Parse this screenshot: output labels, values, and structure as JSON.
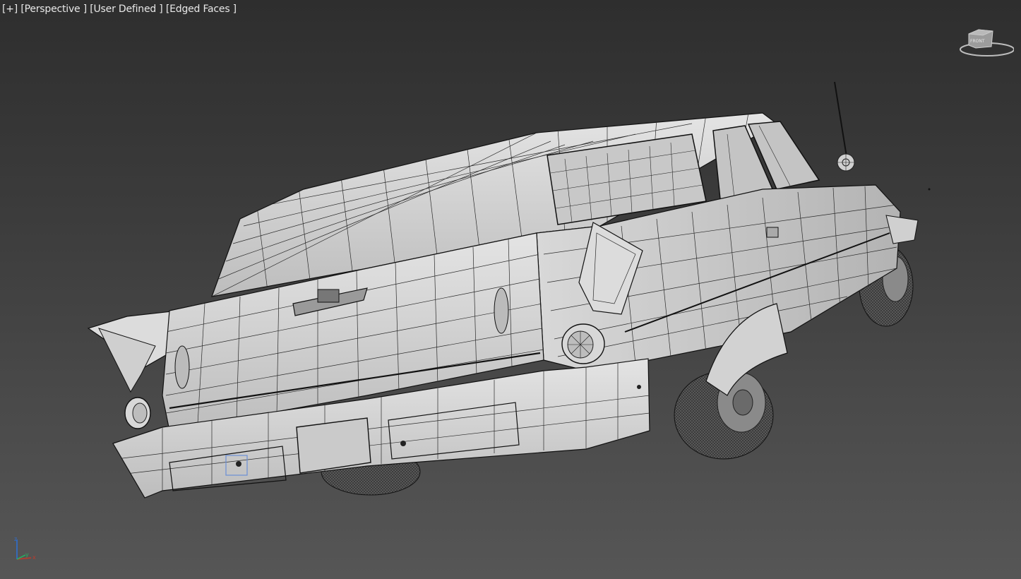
{
  "viewport": {
    "label_plus": "[+]",
    "label_view": "[Perspective ]",
    "label_camera": "[User Defined ]",
    "label_shading": "[Edged Faces ]"
  },
  "viewcube": {
    "face_label": "FRONT",
    "icon": "viewcube-icon"
  },
  "axis_tripod": {
    "x": "x",
    "y": "y",
    "z": "z"
  },
  "colors": {
    "background_top": "#2e2e2e",
    "background_bottom": "#565656",
    "model_surface": "#cfcfcf",
    "wire": "#1a1a1a",
    "x_axis": "#c0392b",
    "y_axis": "#27ae60",
    "z_axis": "#2e6fd1"
  }
}
